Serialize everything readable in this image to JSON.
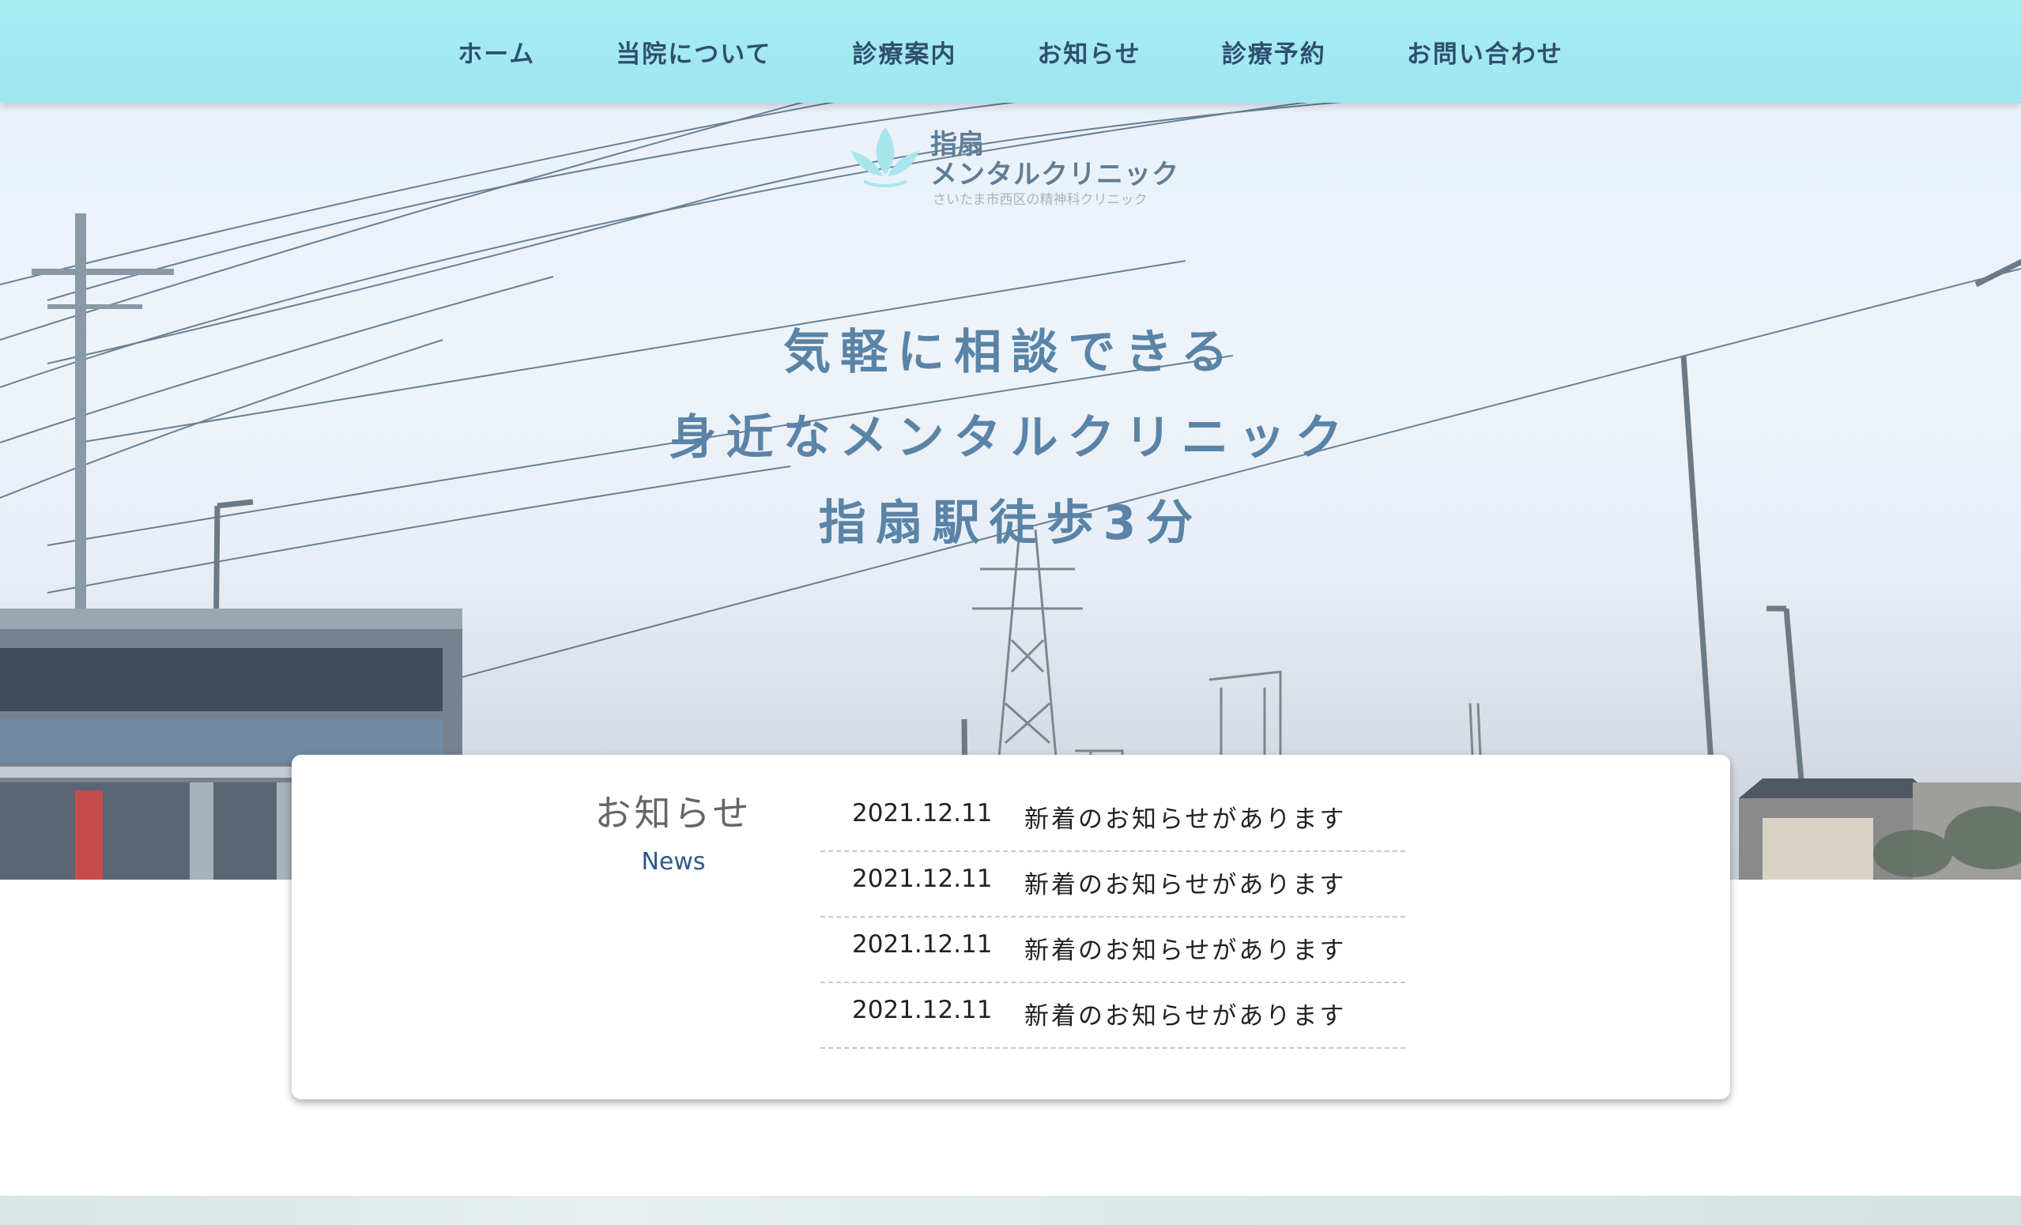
{
  "nav": {
    "items": [
      {
        "label": "ホーム"
      },
      {
        "label": "当院について"
      },
      {
        "label": "診療案内"
      },
      {
        "label": "お知らせ"
      },
      {
        "label": "診療予約"
      },
      {
        "label": "お問い合わせ"
      }
    ]
  },
  "logo": {
    "name_line1": "指扇",
    "name_line2": "メンタルクリニック",
    "tagline": "さいたま市西区の精神科クリニック",
    "icon": "lotus-leaf-icon",
    "color": "#a8e6ee"
  },
  "hero": {
    "lines": [
      "気軽に相談できる",
      "身近なメンタルクリニック",
      "指扇駅徒歩3分"
    ],
    "text_color": "#5a84a7"
  },
  "news": {
    "title": "お知らせ",
    "subtitle": "News",
    "items": [
      {
        "date": "2021.12.11",
        "text": "新着のお知らせがあります"
      },
      {
        "date": "2021.12.11",
        "text": "新着のお知らせがあります"
      },
      {
        "date": "2021.12.11",
        "text": "新着のお知らせがあります"
      },
      {
        "date": "2021.12.11",
        "text": "新着のお知らせがあります"
      }
    ]
  },
  "colors": {
    "nav_background": "#a7ecf3",
    "nav_text": "#2f4f6f",
    "news_subtitle": "#2e5a86"
  }
}
